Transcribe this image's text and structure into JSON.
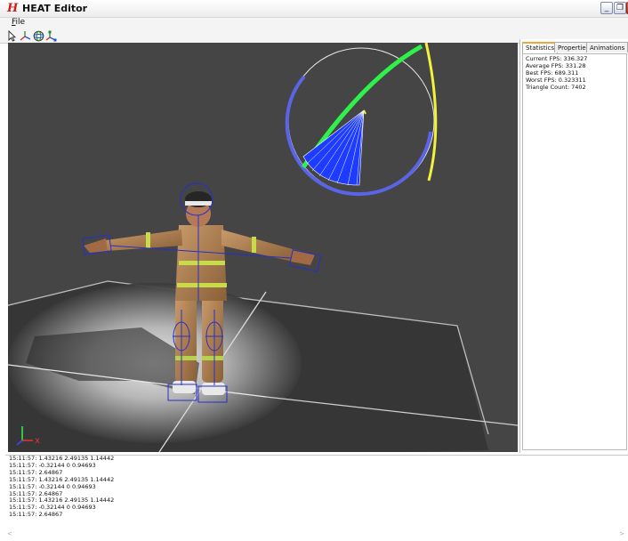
{
  "window": {
    "title": "HEAT Editor",
    "icon_glyph": "H",
    "icon_color": "#c81e1e"
  },
  "menu": {
    "file_accel": "F",
    "file_rest": "ile"
  },
  "toolbar": {
    "tools": [
      "select-arrow-icon",
      "translate-axes-icon",
      "rotate-gizmo-icon",
      "scale-axes-icon"
    ]
  },
  "viewport": {
    "background": "#454545",
    "axis_label": "x",
    "model": "firefighter-character",
    "gizmo_colors": {
      "x_ring": "#5a64e6",
      "y_ring": "#2ef24a",
      "z_ring": "#f2f23c",
      "sector": "#1e3cff"
    }
  },
  "panel": {
    "tabs": [
      "Statistics",
      "Properties",
      "Animations"
    ],
    "active_tab": "Statistics",
    "stats": [
      "Current FPS: 336.327",
      "Average FPS: 331.28",
      "Best FPS: 689.311",
      "Worst FPS: 0.323311",
      "Triangle Count: 7402"
    ]
  },
  "log": [
    "15:11:57: 1.43216 2.49135 1.14442",
    "15:11:57: -0.32144 0 0.94693",
    "15:11:57: 2.64867",
    "15:11:57: 1.43216 2.49135 1.14442",
    "15:11:57: -0.32144 0 0.94693",
    "15:11:57: 2.64867",
    "15:11:57: 1.43216 2.49135 1.14442",
    "15:11:57: -0.32144 0 0.94693",
    "15:11:57: 2.64867"
  ],
  "log_scroll": {
    "left": "<",
    "right": ">"
  }
}
